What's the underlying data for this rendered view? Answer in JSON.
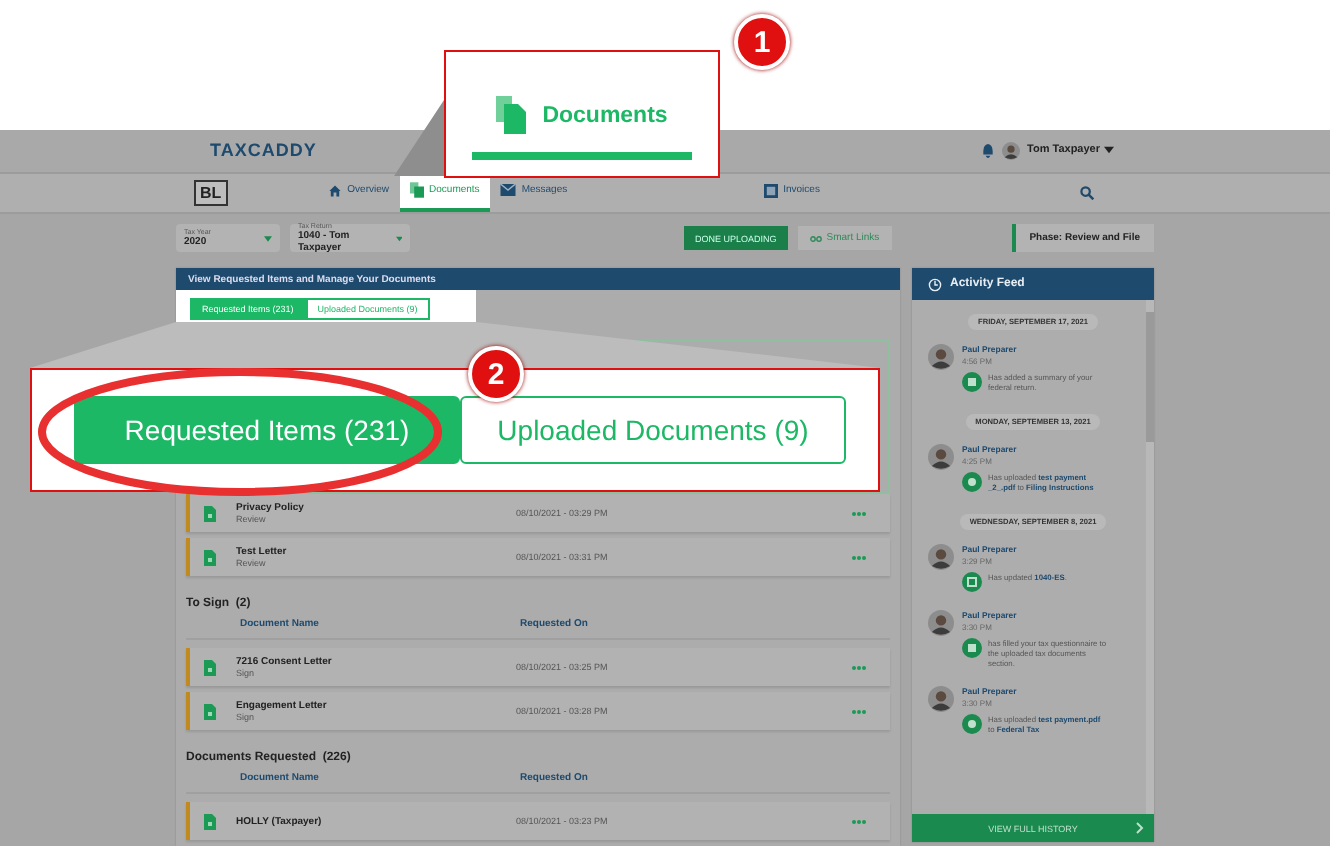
{
  "header": {
    "logo": "TAXCADDY",
    "user": "Tom Taxpayer"
  },
  "nav": {
    "logo": "BL",
    "tabs": [
      {
        "label": "Overview",
        "selected": false,
        "kind": "home"
      },
      {
        "label": "Documents",
        "selected": true,
        "kind": "doc"
      },
      {
        "label": "Messages",
        "selected": false,
        "kind": "mail"
      },
      {
        "label": "Invoices",
        "selected": false,
        "kind": "invoice"
      }
    ]
  },
  "toolbar": {
    "filters": [
      {
        "label": "Tax Year",
        "value": "2020"
      },
      {
        "label": "Tax Return",
        "value": "1040 - Tom Taxpayer"
      }
    ],
    "done_button": "DONE UPLOADING",
    "smart_links": "Smart Links",
    "phase": "Phase: Review and File"
  },
  "panel": {
    "title": "View Requested Items and Manage Your Documents",
    "tabs": [
      {
        "label": "Requested Items (231)",
        "selected": true
      },
      {
        "label": "Uploaded Documents (9)",
        "selected": false
      }
    ],
    "groups": [
      {
        "rows": [
          {
            "name": "Privacy Policy",
            "action": "Review",
            "date": "08/10/2021 - 03:29 PM"
          },
          {
            "name": "Test Letter",
            "action": "Review",
            "date": "08/10/2021 - 03:31 PM"
          }
        ]
      },
      {
        "title": "To Sign",
        "count": "(2)",
        "columns": [
          "Document Name",
          "Requested On"
        ],
        "rows": [
          {
            "name": "7216 Consent Letter",
            "action": "Sign",
            "date": "08/10/2021 - 03:25 PM"
          },
          {
            "name": "Engagement Letter",
            "action": "Sign",
            "date": "08/10/2021 - 03:28 PM"
          }
        ]
      },
      {
        "title": "Documents Requested",
        "count": "(226)",
        "columns": [
          "Document Name",
          "Requested On"
        ],
        "rows": [
          {
            "name": "HOLLY (Taxpayer)",
            "date": "08/10/2021 - 03:23 PM"
          }
        ]
      }
    ]
  },
  "feed": {
    "title": "Activity Feed",
    "days": [
      {
        "date": "FRIDAY, SEPTEMBER 17, 2021",
        "entries": [
          {
            "name": "Paul Preparer",
            "time": "4:56 PM",
            "message": "Has added a summary of your federal return."
          }
        ]
      },
      {
        "date": "MONDAY, SEPTEMBER 13, 2021",
        "entries": [
          {
            "name": "Paul Preparer",
            "time": "4:25 PM",
            "message": "Has uploaded **test payment _2_.pdf** to **Filing Instructions**"
          }
        ]
      },
      {
        "date": "WEDNESDAY, SEPTEMBER 8, 2021",
        "entries": [
          {
            "name": "Paul Preparer",
            "time": "3:29 PM",
            "message": "Has updated **1040-ES**."
          },
          {
            "name": "Paul Preparer",
            "time": "3:30 PM",
            "message": "has filled your tax questionnaire to the uploaded tax documents section."
          },
          {
            "name": "Paul Preparer",
            "time": "3:30 PM",
            "message": "Has uploaded **test payment.pdf** to **Federal Tax**"
          }
        ]
      }
    ],
    "footer": "VIEW FULL HISTORY"
  },
  "callout_1": {
    "number": "1",
    "tab": "Documents"
  },
  "callout_2": {
    "number": "2",
    "tabs": [
      {
        "label": "Requested Items (231)",
        "selected": true
      },
      {
        "label": "Uploaded Documents (9)",
        "selected": false
      }
    ]
  }
}
